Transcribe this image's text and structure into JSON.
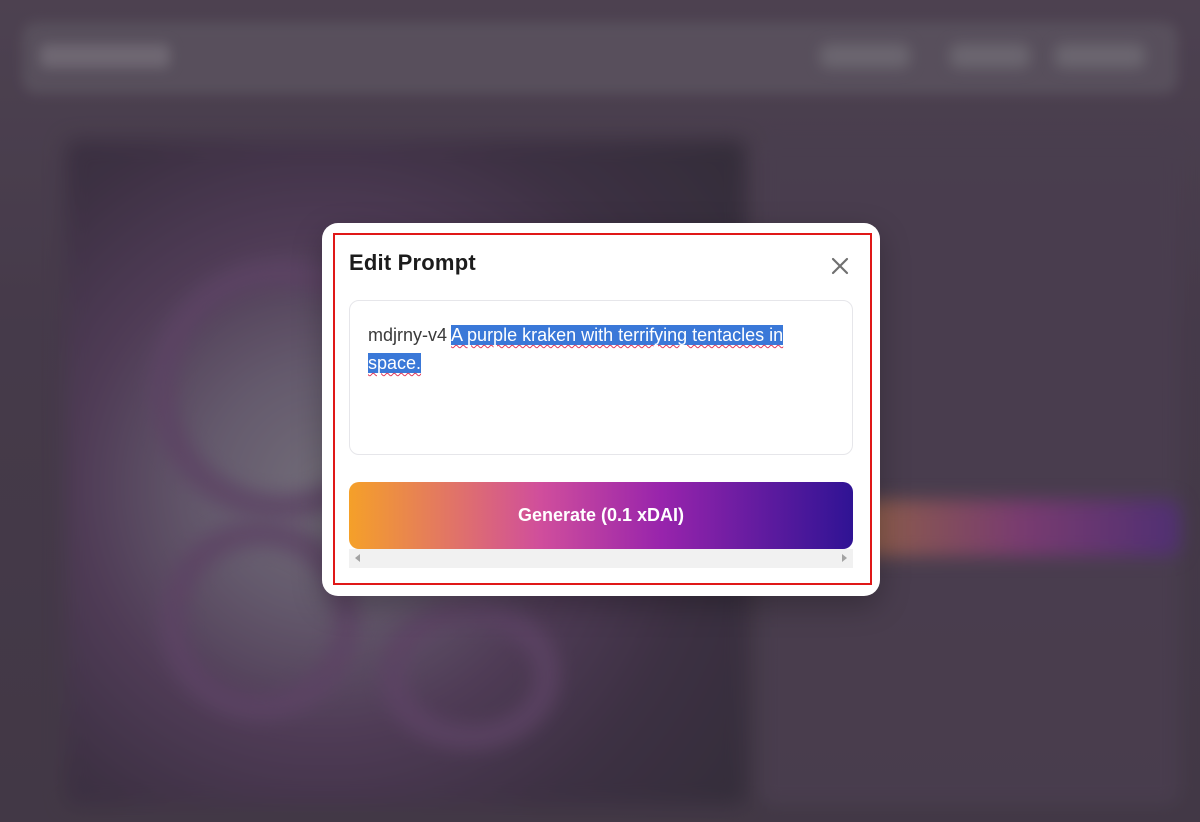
{
  "modal": {
    "title": "Edit Prompt",
    "close_icon": "close-icon",
    "prompt": {
      "model_prefix": "mdjrny-v4",
      "text": "A purple kraken with terrifying tentacles in space."
    },
    "generate_label": "Generate (0.1 xDAI)"
  },
  "colors": {
    "accent_selection": "#3a78d8",
    "highlight_frame": "#e01818",
    "gradient_start": "#f5a029",
    "gradient_end": "#2f1394"
  }
}
